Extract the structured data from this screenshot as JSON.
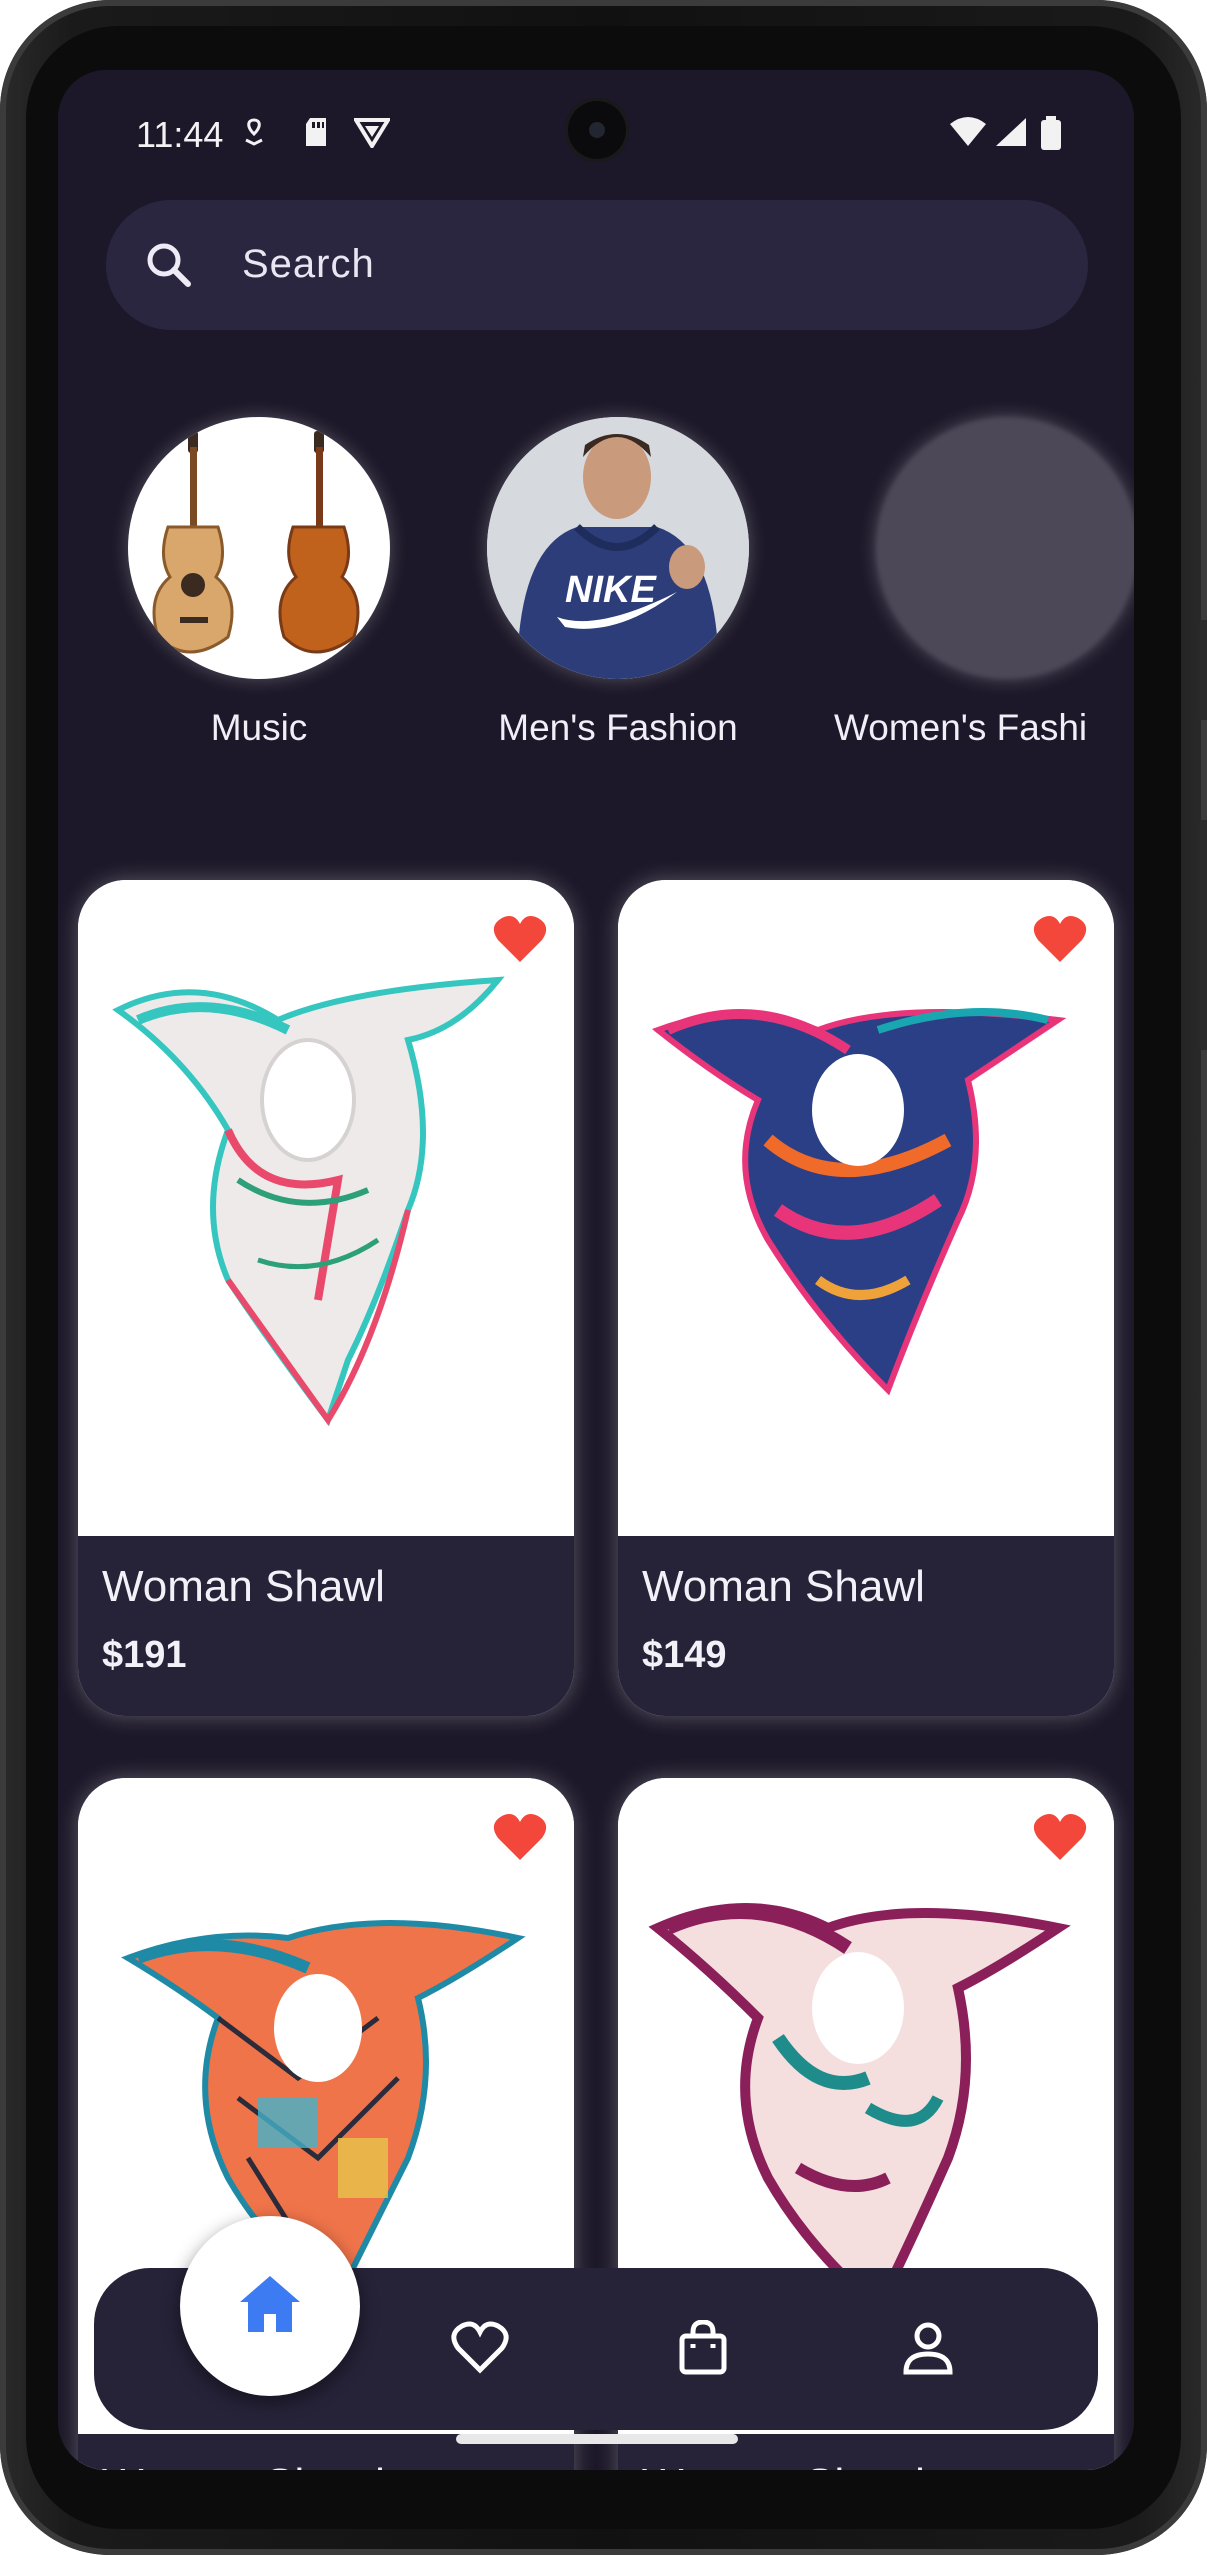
{
  "status_bar": {
    "time": "11:44"
  },
  "search": {
    "placeholder": "Search"
  },
  "categories": [
    {
      "label": "Music"
    },
    {
      "label": "Men's Fashion"
    },
    {
      "label": "Women's Fashi"
    }
  ],
  "products": [
    {
      "name": "Woman Shawl",
      "price": "$191",
      "favorite": true
    },
    {
      "name": "Woman Shawl",
      "price": "$149",
      "favorite": true
    },
    {
      "name": "Woman Shawl",
      "price": "",
      "favorite": true
    },
    {
      "name": "Woman Shawl",
      "price": "",
      "favorite": true
    }
  ],
  "bottom_nav": {
    "items": [
      "home-icon",
      "heart-outline-icon",
      "shopping-bag-icon",
      "person-icon"
    ],
    "active": "home-icon"
  },
  "colors": {
    "background": "#1c1829",
    "surface": "#262238",
    "search_bg": "#2b2640",
    "heart": "#f4473b",
    "accent": "#3d7bf2"
  }
}
